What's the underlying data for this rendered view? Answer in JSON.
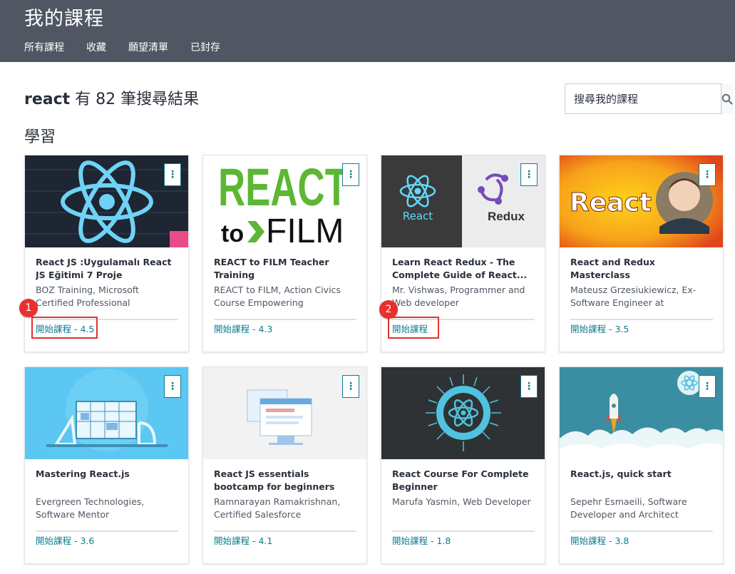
{
  "header": {
    "title": "我的課程",
    "tabs": [
      {
        "label": "所有課程"
      },
      {
        "label": "收藏"
      },
      {
        "label": "願望清單"
      },
      {
        "label": "已封存"
      }
    ]
  },
  "search": {
    "query": "react",
    "result_text": "有 82 筆搜尋結果",
    "placeholder": "搜尋我的課程"
  },
  "section_label": "學習",
  "courses": [
    {
      "title": "React JS :Uygulamalı React JS Eğitimi 7 Proje",
      "author": "BOZ Training, Microsoft Certified Professional",
      "action": "開始課程",
      "rating": "- 4.5"
    },
    {
      "title": "REACT to FILM Teacher Training",
      "author": "REACT to FILM, Action Civics Course Empowering Middle/Hig...",
      "action": "開始課程",
      "rating": "- 4.3",
      "thumb_text_1": "REACT",
      "thumb_text_2": "to",
      "thumb_text_3": "FILM"
    },
    {
      "title": "Learn React Redux - The Complete Guide of React...",
      "author": "Mr. Vishwas, Programmer and Web developer",
      "action": "開始課程",
      "rating": "",
      "thumb_text_1": "React",
      "thumb_text_2": "Redux"
    },
    {
      "title": "React and Redux Masterclass",
      "author": "Mateusz Grzesiukiewicz, Ex-Software Engineer at Atlassian....",
      "action": "開始課程",
      "rating": "- 3.5",
      "thumb_text_1": "React"
    },
    {
      "title": "Mastering React.js",
      "author": "Evergreen Technologies, Software Mentor",
      "action": "開始課程",
      "rating": "- 3.6"
    },
    {
      "title": "React JS essentials bootcamp for beginners",
      "author": "Ramnarayan Ramakrishnan, Certified Salesforce Professional",
      "action": "開始課程",
      "rating": "- 4.1"
    },
    {
      "title": "React Course For Complete Beginner",
      "author": "Marufa Yasmin, Web Developer",
      "action": "開始課程",
      "rating": "- 1.8"
    },
    {
      "title": "React.js, quick start",
      "author": "Sepehr Esmaeili, Software Developer and Architect",
      "action": "開始課程",
      "rating": "- 3.8"
    }
  ],
  "annotations": [
    {
      "number": "1"
    },
    {
      "number": "2"
    }
  ],
  "colors": {
    "header_bg": "#505763",
    "accent": "#0f7c90",
    "annotation_red": "#e8312f"
  }
}
